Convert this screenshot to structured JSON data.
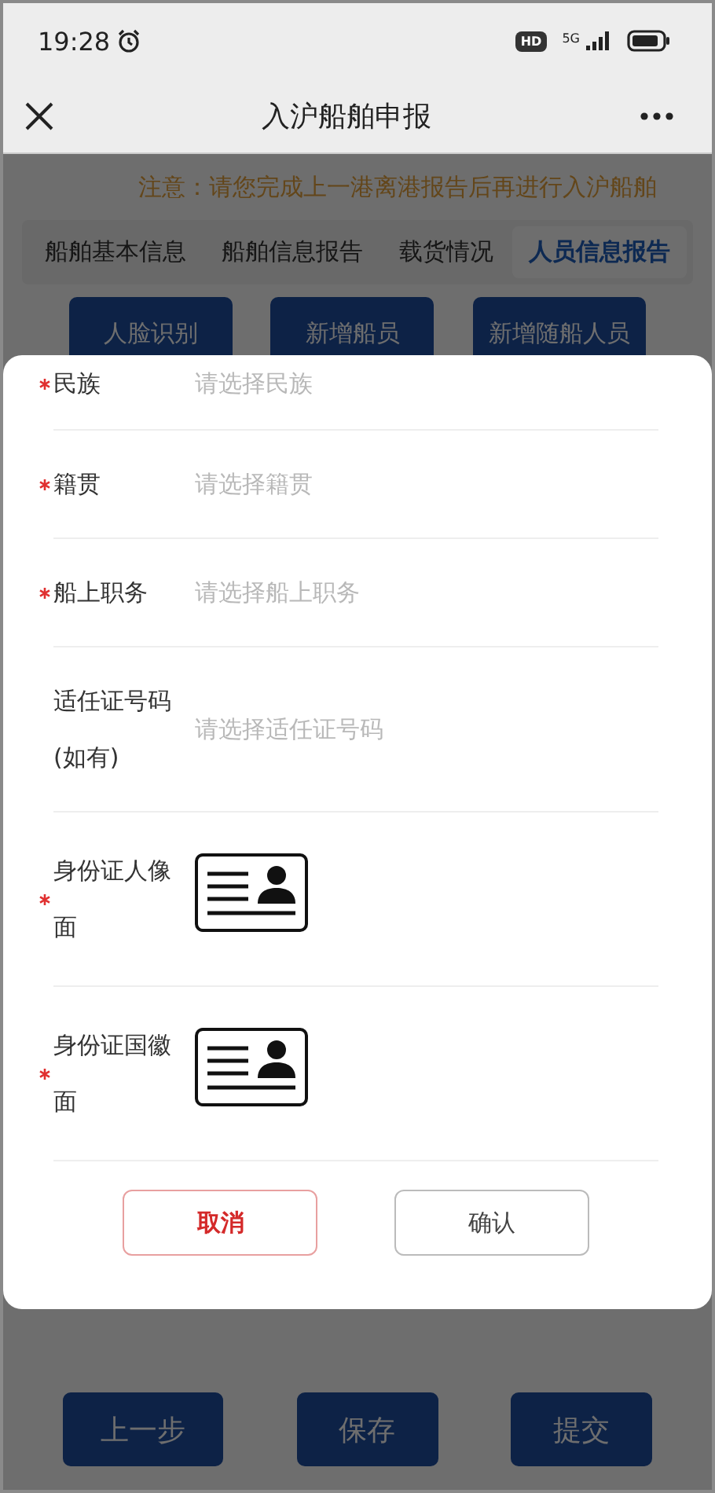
{
  "status_bar": {
    "time": "19:28",
    "hd": "HD",
    "network": "5G"
  },
  "header": {
    "title": "入沪船舶申报"
  },
  "notice": "注意：请您完成上一港离港报告后再进行入沪船舶",
  "tabs": [
    {
      "label": "船舶基本信息",
      "selected": false
    },
    {
      "label": "船舶信息报告",
      "selected": false
    },
    {
      "label": "载货情况",
      "selected": false
    },
    {
      "label": "人员信息报告",
      "selected": true
    }
  ],
  "action_buttons": [
    "人脸识别",
    "新增船员",
    "新增随船人员"
  ],
  "dialog": {
    "fields": [
      {
        "kind": "select",
        "label": "民族",
        "required": true,
        "placeholder": "请选择民族"
      },
      {
        "kind": "select",
        "label": "籍贯",
        "required": true,
        "placeholder": "请选择籍贯"
      },
      {
        "kind": "select",
        "label": "船上职务",
        "required": true,
        "placeholder": "请选择船上职务"
      },
      {
        "kind": "select",
        "label": "适任证号码(如有)",
        "required": false,
        "placeholder": "请选择适任证号码"
      },
      {
        "kind": "upload",
        "label": "身份证人像面",
        "required": true
      },
      {
        "kind": "upload",
        "label": "身份证国徽面",
        "required": true
      }
    ],
    "buttons": [
      {
        "kind": "cancel",
        "label": "取消"
      },
      {
        "kind": "confirm",
        "label": "确认"
      }
    ]
  },
  "footer_buttons": [
    "上一步",
    "保存",
    "提交"
  ]
}
